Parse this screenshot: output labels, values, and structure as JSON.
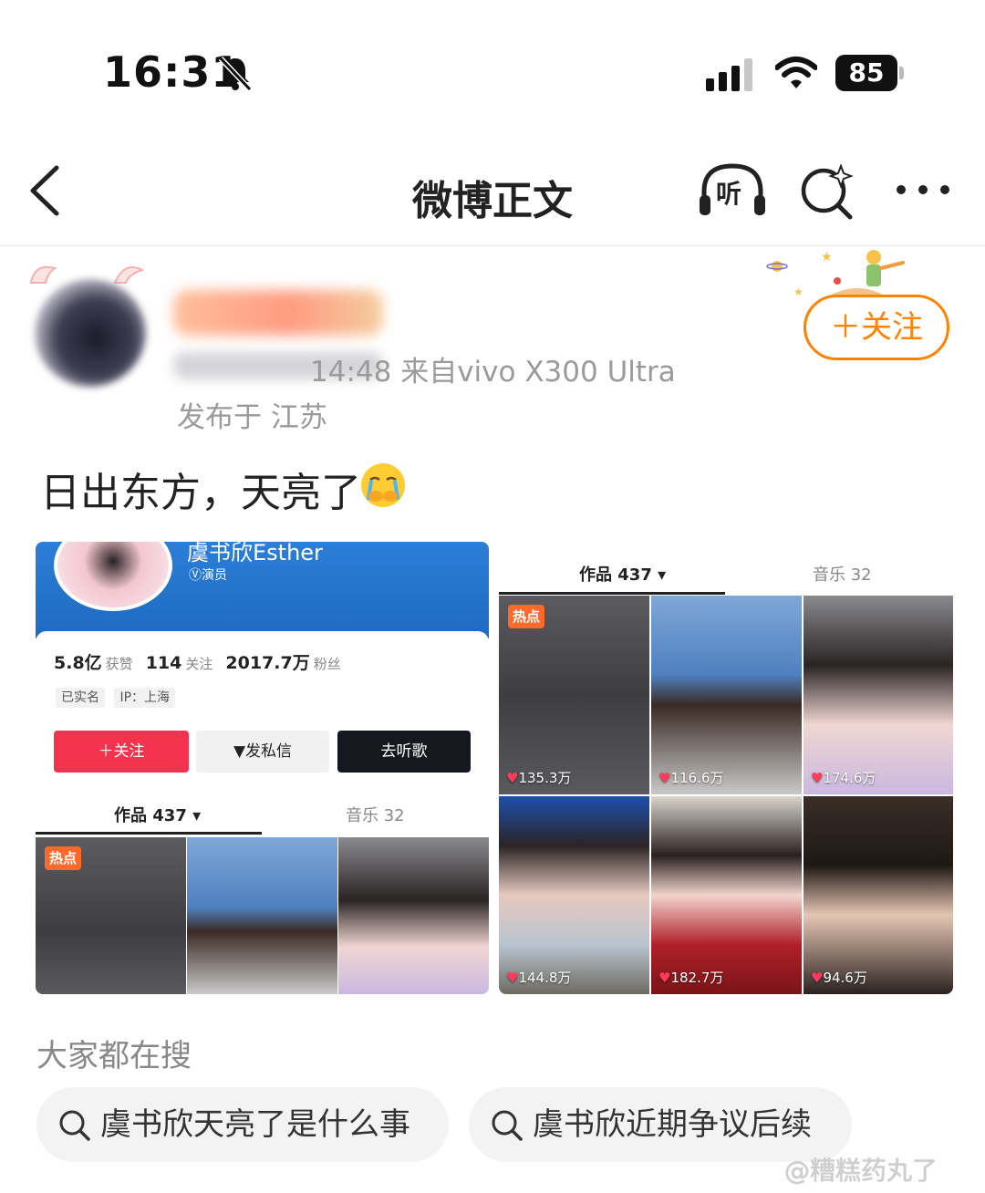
{
  "status_bar": {
    "time": "16:31",
    "battery": "85"
  },
  "nav": {
    "title": "微博正文",
    "listen_label": "听"
  },
  "post": {
    "meta": "14:48  来自vivo X300 Ultra",
    "location": "发布于 江苏",
    "follow_label": "＋关注",
    "text": "日出东方，天亮了"
  },
  "screenshot_left": {
    "name": "虞书欣Esther",
    "role": "Ⓥ演员",
    "stats": [
      {
        "value": "5.8亿",
        "label": "获赞"
      },
      {
        "value": "114",
        "label": "关注"
      },
      {
        "value": "2017.7万",
        "label": "粉丝"
      }
    ],
    "tags": [
      "已实名",
      "IP：上海"
    ],
    "buttons": {
      "follow": "＋关注",
      "message": "▼发私信",
      "listen": "去听歌"
    },
    "tabs": {
      "works": "作品 437 ▾",
      "music": "音乐 32"
    },
    "hot": "热点"
  },
  "screenshot_right": {
    "tabs": {
      "works": "作品 437 ▾",
      "music": "音乐 32"
    },
    "hot": "热点",
    "likes": [
      "135.3万",
      "116.6万",
      "174.6万",
      "144.8万",
      "182.7万",
      "94.6万"
    ]
  },
  "search": {
    "title": "大家都在搜",
    "chips": [
      "虞书欣天亮了是什么事",
      "虞书欣近期争议后续"
    ]
  },
  "watermark": "@糟糕药丸了",
  "colors": {
    "accent": "#ff8200",
    "follow_red": "#f5334f",
    "banner_blue": "#2c7ed6"
  }
}
